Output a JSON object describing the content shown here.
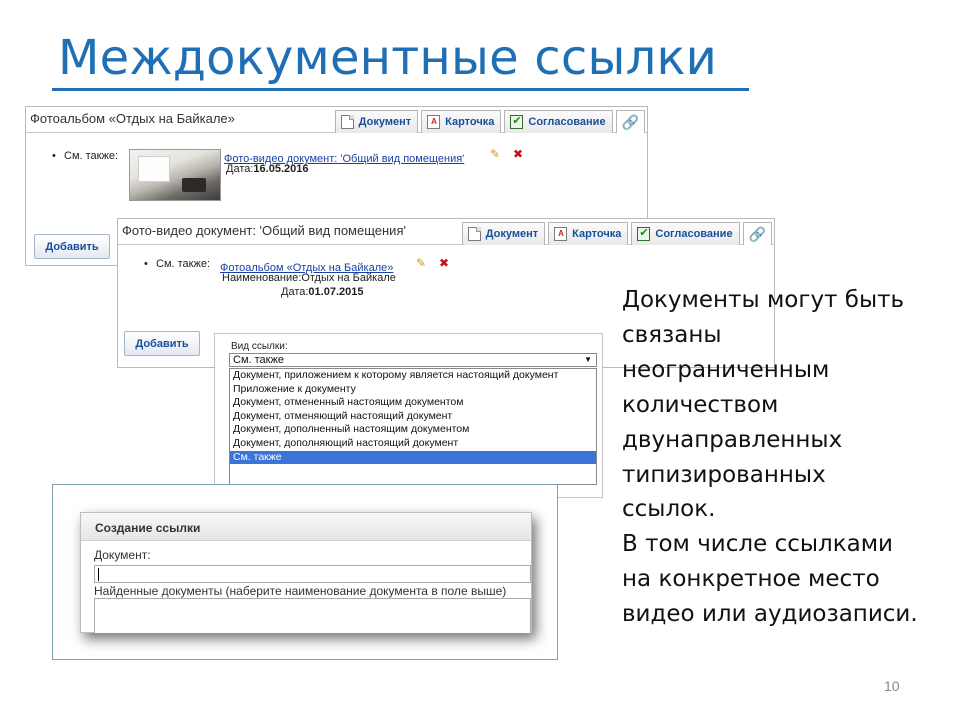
{
  "slide": {
    "title": "Междокументные ссылки",
    "page_number": "10",
    "body_lines": [
      "Документы могут быть",
      "связаны",
      "неограниченным",
      "количеством",
      "двунаправленных",
      "типизированных",
      "ссылок.",
      "В том числе ссылками",
      "на конкретное  место",
      "видео или аудиозаписи."
    ]
  },
  "window1": {
    "title": "Фотоальбом «Отдых на Байкале»",
    "tabs": [
      "Документ",
      "Карточка",
      "Согласование"
    ],
    "see_also_label": "См. также:",
    "link_text": "Фото-видео документ: 'Общий вид помещения'",
    "date_label": "Дата:",
    "date_value": "16.05.2016",
    "add_button": "Добавить"
  },
  "window2": {
    "title": "Фото-видео документ: 'Общий вид помещения'",
    "tabs": [
      "Документ",
      "Карточка",
      "Согласование"
    ],
    "see_also_label": "См. также:",
    "link_text": "Фотоальбом «Отдых на Байкале»",
    "name_label": "Наименование:",
    "name_value": "Отдых на Байкале",
    "date_label": "Дата:",
    "date_value": "01.07.2015",
    "add_button": "Добавить"
  },
  "link_type": {
    "label": "Вид ссылки:",
    "selected": "См. также",
    "options": [
      "Документ, приложением к которому является настоящий документ",
      "Приложение к документу",
      "Документ, отмененный настоящим документом",
      "Документ, отменяющий настоящий документ",
      "Документ, дополненный настоящим документом",
      "Документ, дополняющий настоящий документ",
      "См. также"
    ]
  },
  "create_link": {
    "title": "Создание ссылки",
    "document_label": "Документ:",
    "document_value": "",
    "found_label": "Найденные документы (наберите наименование документа в поле выше)"
  },
  "colors": {
    "title_blue": "#1f6fb5",
    "link_blue": "#1a3fa8",
    "selection_blue": "#3a74d6"
  }
}
